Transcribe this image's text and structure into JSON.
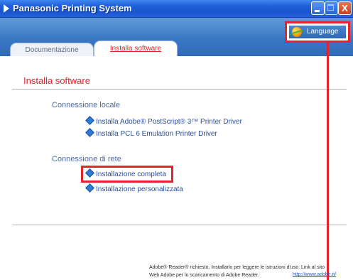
{
  "window": {
    "title": "Panasonic Printing System",
    "close_glyph": "X"
  },
  "header": {
    "language_label": "Language"
  },
  "tabs": [
    {
      "label": "Documentazione",
      "active": false
    },
    {
      "label": "Installa software",
      "active": true
    }
  ],
  "main": {
    "title": "Installa software",
    "sections": [
      {
        "heading": "Connessione locale",
        "items": [
          {
            "label": "Installa Adobe® PostScript® 3™ Printer Driver"
          },
          {
            "label": "Installa PCL 6 Emulation Printer Driver"
          }
        ]
      },
      {
        "heading": "Connessione di rete",
        "items": [
          {
            "label": "Installazione completa",
            "highlighted": true
          },
          {
            "label": "Installazione personalizzata"
          }
        ]
      }
    ]
  },
  "footer": {
    "line1": "Adobe® Reader® richiesto. Installarlo per leggere le istruzioni d'uso. Link al sito",
    "line2": "Web Adobe per lo scaricamento di Adobe Reader.",
    "link": "http://www.adobe.it/"
  },
  "colors": {
    "accent": "#e3242b",
    "titlebar": "#1f5fd9",
    "header_band": "#3a78c4",
    "link": "#2b4f9a",
    "section_heading": "#4a6aa8"
  },
  "icons": {
    "window_icon": "triangle-play-icon",
    "language_icon": "globe-icon",
    "list_bullet": "diamond-icon"
  }
}
